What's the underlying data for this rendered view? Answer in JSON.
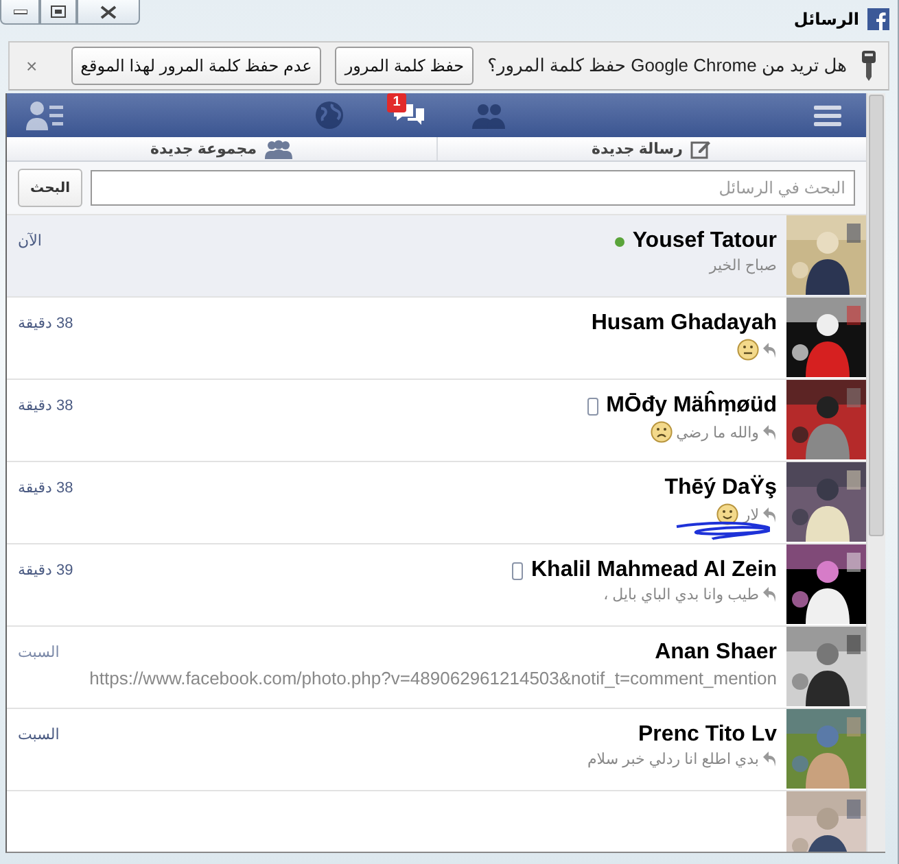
{
  "window": {
    "title": "الرسائل"
  },
  "password_bar": {
    "prompt": "هل تريد من Google Chrome حفظ كلمة المرور؟",
    "buttons": [
      "حفظ كلمة المرور",
      "عدم حفظ كلمة المرور لهذا الموقع"
    ],
    "close": "×"
  },
  "nav": [
    {
      "kind": "menu",
      "selected": false
    },
    {
      "kind": "friends",
      "selected": false
    },
    {
      "kind": "messages",
      "selected": true,
      "badge": "1"
    },
    {
      "kind": "globe",
      "selected": false
    },
    {
      "kind": "contacts",
      "selected": false
    }
  ],
  "actions": [
    {
      "kind": "compose",
      "label": "رسالة جديدة"
    },
    {
      "kind": "group",
      "label": "مجموعة جديدة"
    }
  ],
  "search": {
    "placeholder": "البحث في الرسائل",
    "button": "البحث"
  },
  "conversations": [
    {
      "name": "Yousef Tatour",
      "preview": "صباح الخير",
      "time": "الآن",
      "unread": true,
      "online": true,
      "mobile": false,
      "replied": false,
      "kind": "text"
    },
    {
      "name": "Husam Ghadayah",
      "time": "38 دقيقة",
      "unread": false,
      "online": false,
      "mobile": false,
      "replied": true,
      "emoticon": {
        "kind": "meh"
      },
      "kind": "text"
    },
    {
      "name": "MŌđy Mäĥṃøüd",
      "preview": "والله ما رضي",
      "time": "38 دقيقة",
      "unread": false,
      "online": false,
      "mobile": true,
      "replied": true,
      "emoticon": {
        "kind": "frown"
      },
      "kind": "text"
    },
    {
      "name": "Thēý DaŸş",
      "preview": "لار",
      "time": "38 دقيقة",
      "unread": false,
      "online": false,
      "mobile": false,
      "replied": true,
      "emoticon": {
        "kind": "smile"
      },
      "kind": "text",
      "scribbled": true
    },
    {
      "name": "Khalil Mahmead Al Zein",
      "preview": "طيب وانا بدي الباي بايل ،",
      "time": "39 دقيقة",
      "unread": false,
      "online": false,
      "mobile": true,
      "replied": true,
      "kind": "text"
    },
    {
      "name": "Anan Shaer",
      "preview": "https://www.facebook.com/photo.php?v=489062961214503&notif_t=comment_mention",
      "time": "السبت",
      "unread": false,
      "online": false,
      "mobile": false,
      "replied": false,
      "kind": "link"
    },
    {
      "name": "Prenc Tito Lv",
      "preview": "بدي اطلع انا ردلي خبر سلام",
      "time": "السبت",
      "unread": false,
      "online": false,
      "mobile": false,
      "replied": true,
      "kind": "text"
    }
  ]
}
